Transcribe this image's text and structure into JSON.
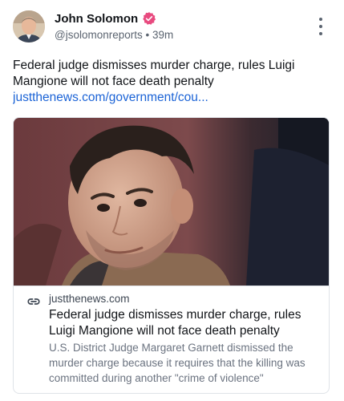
{
  "author": {
    "name": "John Solomon",
    "handle": "@jsolomonreports",
    "separator": "•",
    "time": "39m",
    "verified_icon": "verified-badge-icon",
    "verified_color": "#e84a7f"
  },
  "post": {
    "text": "Federal judge dismisses murder charge, rules Luigi Mangione will not face death penalty",
    "link_text": "justthenews.com/government/cou..."
  },
  "card": {
    "image_alt": "photo-of-man-looking-up",
    "domain": "justthenews.com",
    "title": "Federal judge dismisses murder charge, rules Luigi Mangione will not face death penalty",
    "description": "U.S. District Judge Margaret Garnett dismissed the murder charge because it requires that the killing was committed during another \"crime of violence\""
  },
  "colors": {
    "link": "#1b63d6",
    "text": "#111418",
    "muted": "#5b6470",
    "border": "#dfe3e8"
  }
}
